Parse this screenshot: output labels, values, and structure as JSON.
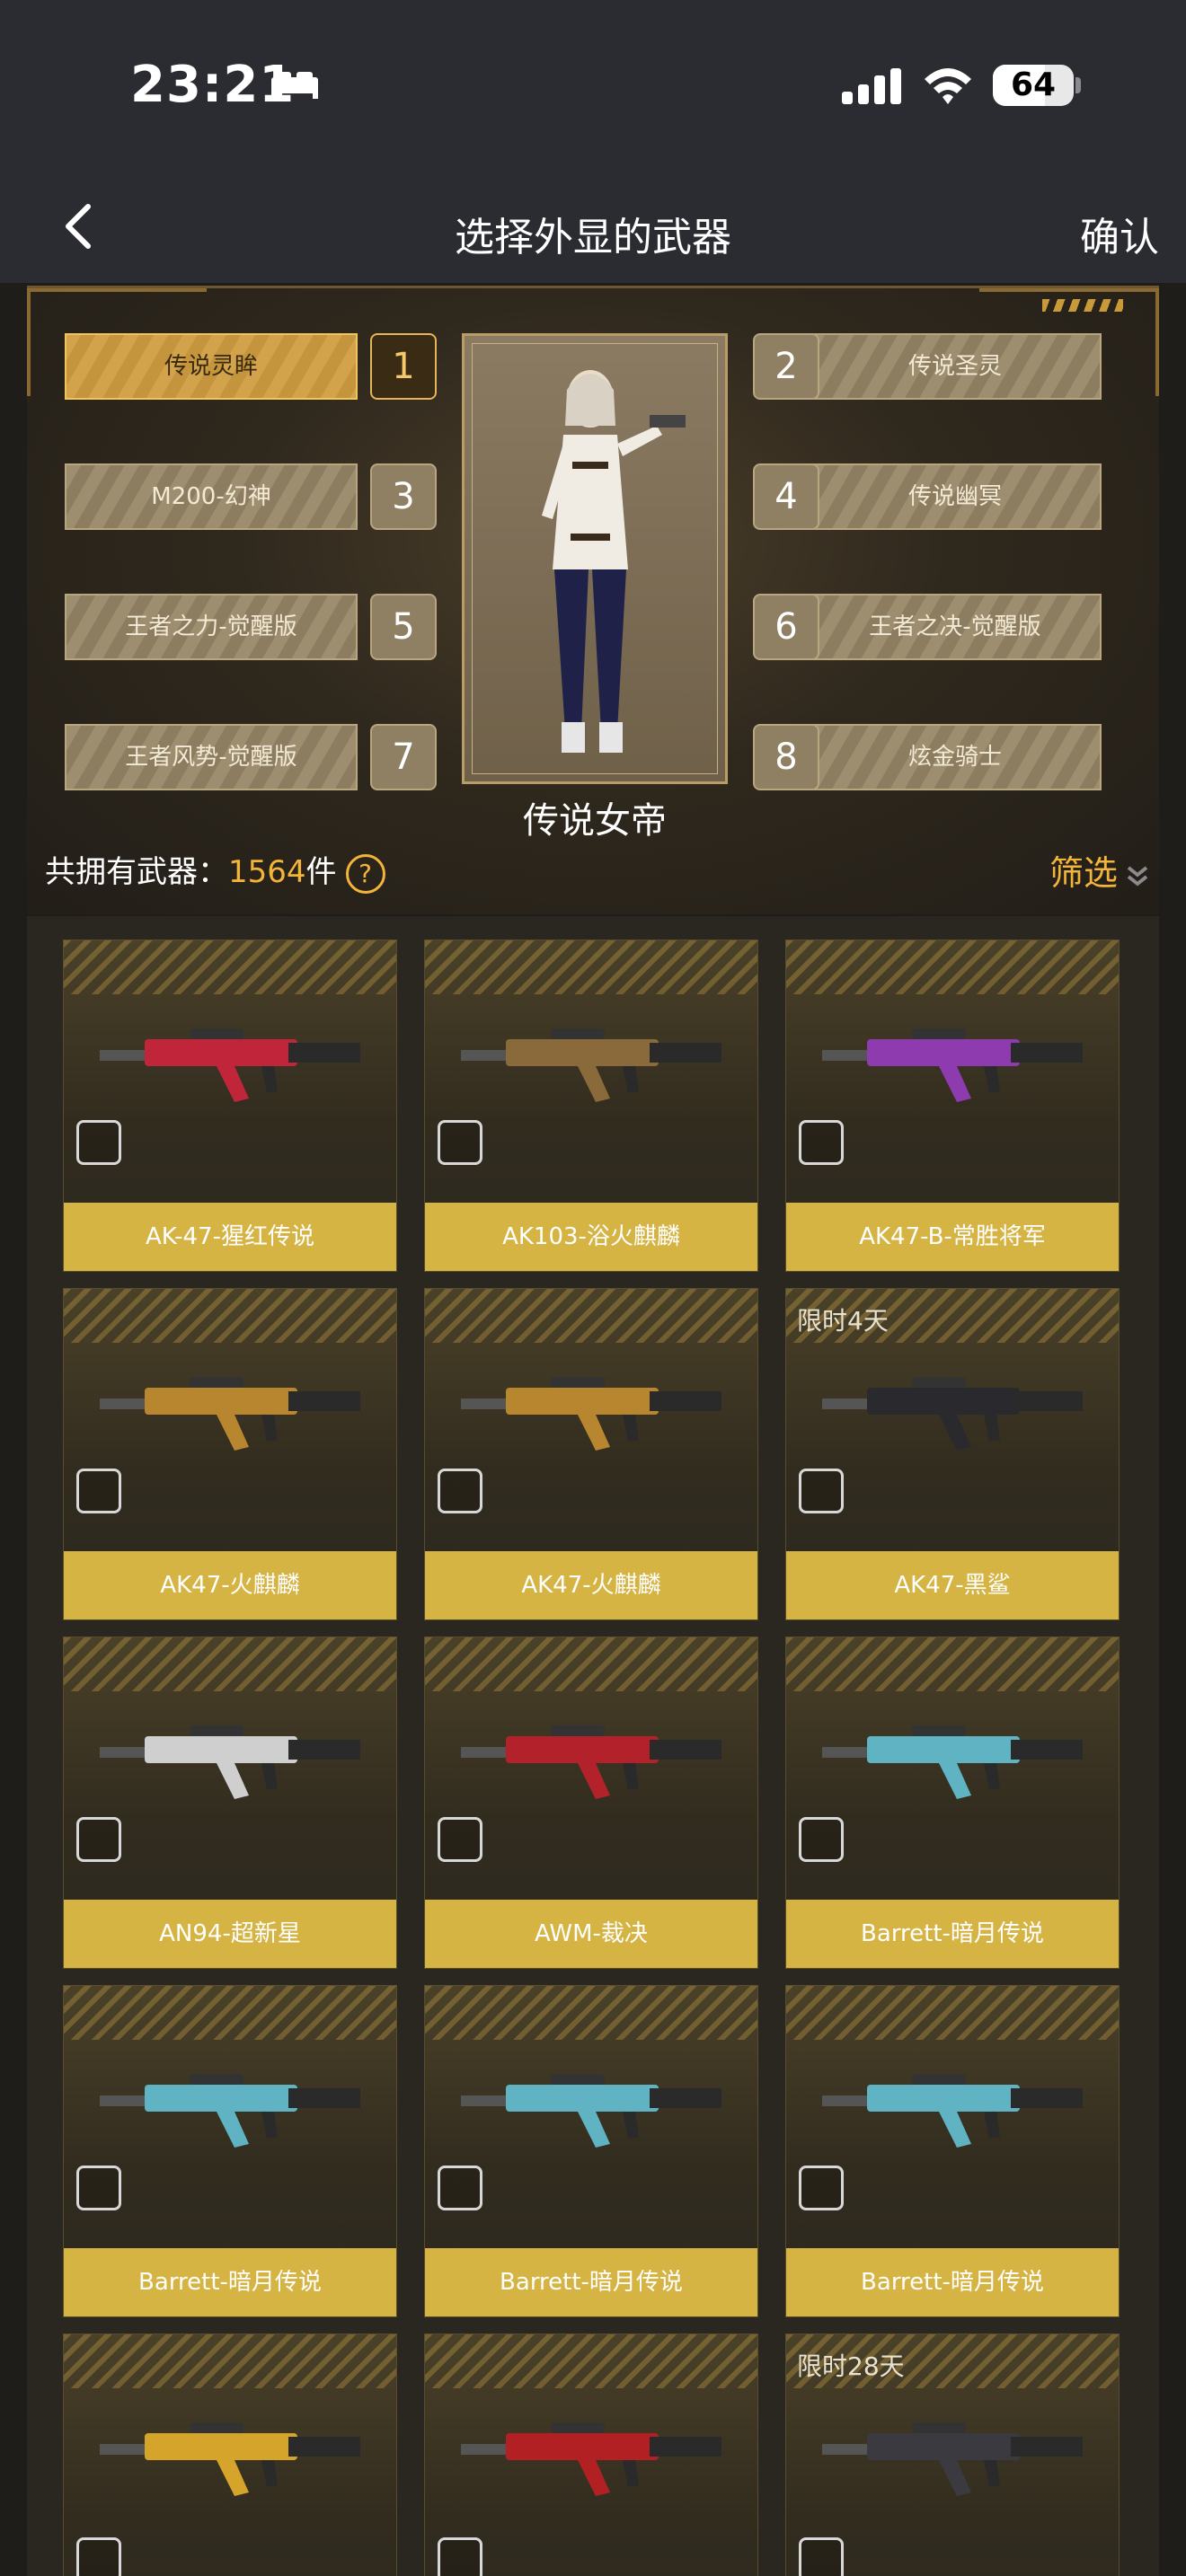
{
  "status": {
    "time": "23:21",
    "battery": "64",
    "battery_level": 0.64
  },
  "nav": {
    "title": "选择外显的武器",
    "confirm": "确认"
  },
  "hero": {
    "name": "传说女帝",
    "slots": [
      {
        "num": "1",
        "label": "传说灵眸",
        "active": true
      },
      {
        "num": "2",
        "label": "传说圣灵",
        "active": false
      },
      {
        "num": "3",
        "label": "M200-幻神",
        "active": false
      },
      {
        "num": "4",
        "label": "传说幽冥",
        "active": false
      },
      {
        "num": "5",
        "label": "王者之力-觉醒版",
        "active": false
      },
      {
        "num": "6",
        "label": "王者之决-觉醒版",
        "active": false
      },
      {
        "num": "7",
        "label": "王者风势-觉醒版",
        "active": false
      },
      {
        "num": "8",
        "label": "炫金骑士",
        "active": false
      }
    ],
    "count_label": "共拥有武器：",
    "count_value": "1564",
    "count_unit": "件",
    "help": "?",
    "filter": "筛选"
  },
  "weapons": [
    {
      "name": "AK-47-猩红传说",
      "tag": "",
      "color": "#c0253a"
    },
    {
      "name": "AK103-浴火麒麟",
      "tag": "",
      "color": "#8a6a3a"
    },
    {
      "name": "AK47-B-常胜将军",
      "tag": "",
      "color": "#8e3bb0"
    },
    {
      "name": "AK47-火麒麟",
      "tag": "",
      "color": "#b8862e"
    },
    {
      "name": "AK47-火麒麟",
      "tag": "",
      "color": "#b8862e"
    },
    {
      "name": "AK47-黑鲨",
      "tag": "限时4天",
      "color": "#2a2a2e"
    },
    {
      "name": "AN94-超新星",
      "tag": "",
      "color": "#cfcfcf"
    },
    {
      "name": "AWM-裁决",
      "tag": "",
      "color": "#b3212a"
    },
    {
      "name": "Barrett-暗月传说",
      "tag": "",
      "color": "#5fb3c2"
    },
    {
      "name": "Barrett-暗月传说",
      "tag": "",
      "color": "#5fb3c2"
    },
    {
      "name": "Barrett-暗月传说",
      "tag": "",
      "color": "#5fb3c2"
    },
    {
      "name": "Barrett-暗月传说",
      "tag": "",
      "color": "#5fb3c2"
    },
    {
      "name": "",
      "tag": "",
      "color": "#d4a52a"
    },
    {
      "name": "",
      "tag": "",
      "color": "#b32024"
    },
    {
      "name": "",
      "tag": "限时28天",
      "color": "#3a3a40"
    }
  ]
}
